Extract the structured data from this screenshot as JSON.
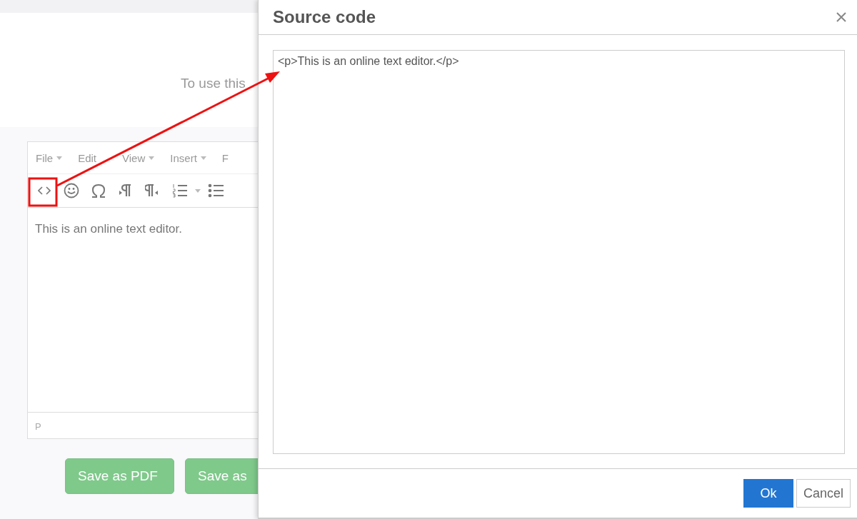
{
  "page": {
    "intro": "To use this"
  },
  "editor": {
    "menu": [
      {
        "label": "File",
        "caret": true
      },
      {
        "label": "Edit",
        "caret": false
      },
      {
        "label": "View",
        "caret": true
      },
      {
        "label": "Insert",
        "caret": true
      },
      {
        "label": "F",
        "caret": false
      }
    ],
    "toolbar": [
      {
        "kind": "code"
      },
      {
        "kind": "emoticon"
      },
      {
        "kind": "omega"
      },
      {
        "kind": "ltr"
      },
      {
        "kind": "rtl"
      },
      {
        "kind": "numbered-list"
      },
      {
        "kind": "caret"
      },
      {
        "kind": "bullet-list"
      }
    ],
    "content": "This is an online text editor.",
    "status": "P"
  },
  "buttons": [
    "Save as PDF",
    "Save as"
  ],
  "dialog": {
    "title": "Source code",
    "source": "<p>This is an online text editor.</p>",
    "buttons": [
      {
        "label": "Ok",
        "primary": true
      },
      {
        "label": "Cancel",
        "primary": false
      }
    ]
  }
}
